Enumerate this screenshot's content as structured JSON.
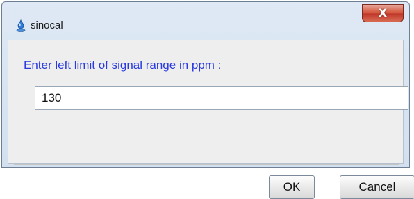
{
  "window": {
    "title": "sinocal",
    "app_icon": "sinocal-app-icon",
    "close_icon": "close-icon",
    "close_label": "X"
  },
  "dialog": {
    "prompt": "Enter left limit of signal range in ppm :",
    "input_value": "130",
    "ok_label": "OK",
    "cancel_label": "Cancel"
  },
  "colors": {
    "prompt_text": "#2a3ae0",
    "close_button": "#c0392b",
    "frame": "#d2e0f0"
  }
}
